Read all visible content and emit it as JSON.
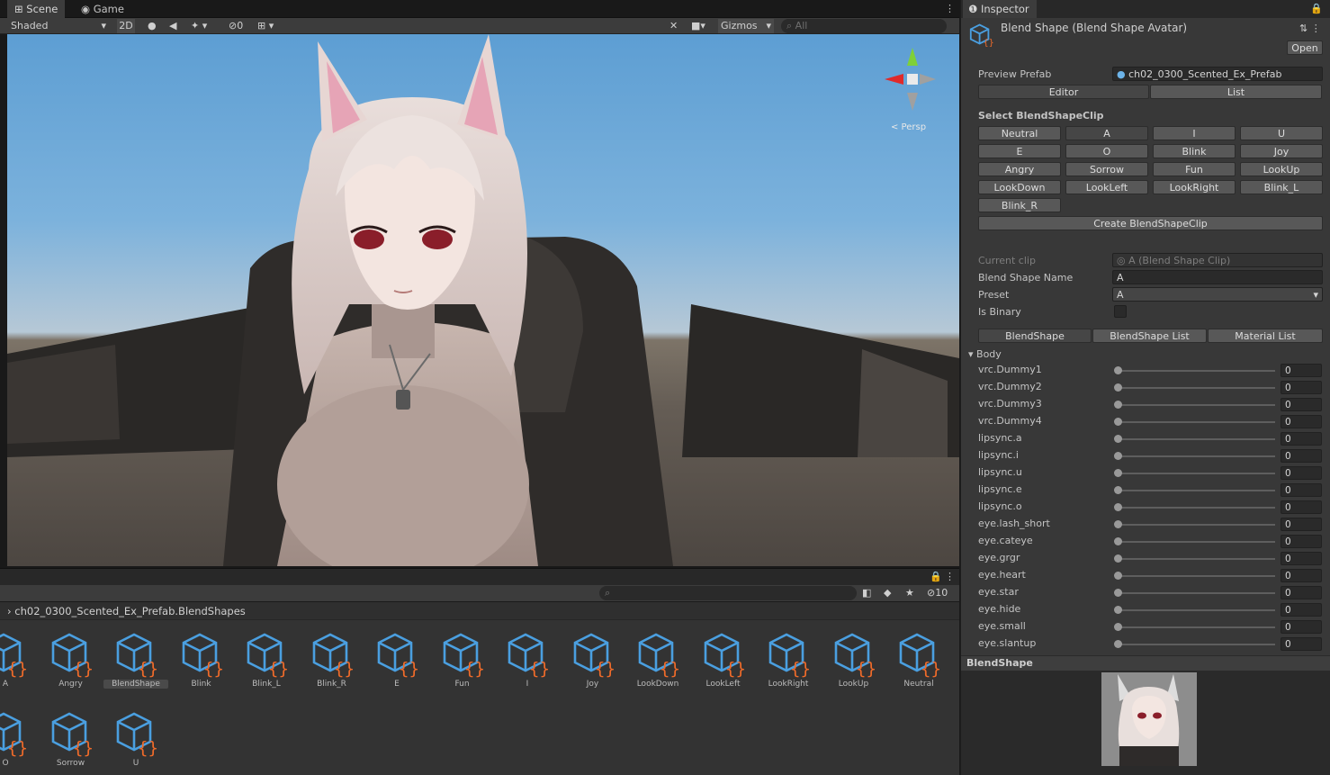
{
  "scene": {
    "tabs": [
      {
        "label": "Scene",
        "icon": "grid-icon"
      },
      {
        "label": "Game",
        "icon": "gamepad-icon"
      }
    ],
    "shading_mode": "Shaded",
    "toggle_2d": "2D",
    "hidden_count": "0",
    "gizmos_label": "Gizmos",
    "search_placeholder": "All",
    "persp_label": "< Persp"
  },
  "project": {
    "breadcrumb": "ch02_0300_Scented_Ex_Prefab.BlendShapes",
    "hidden_count": "10",
    "assets": [
      "A",
      "Angry",
      "BlendShape",
      "Blink",
      "Blink_L",
      "Blink_R",
      "E",
      "Fun",
      "I",
      "Joy",
      "LookDown",
      "LookLeft",
      "LookRight",
      "LookUp",
      "Neutral",
      "O",
      "Sorrow",
      "U"
    ],
    "selected_asset": "BlendShape"
  },
  "inspector": {
    "tab_label": "Inspector",
    "title": "Blend Shape (Blend Shape Avatar)",
    "open_button": "Open",
    "preview_prefab_label": "Preview Prefab",
    "preview_prefab_value": "ch02_0300_Scented_Ex_Prefab",
    "mode_tabs": [
      "Editor",
      "List"
    ],
    "select_clip_heading": "Select BlendShapeClip",
    "clip_buttons": [
      "Neutral",
      "A",
      "I",
      "U",
      "E",
      "O",
      "Blink",
      "Joy",
      "Angry",
      "Sorrow",
      "Fun",
      "LookUp",
      "LookDown",
      "LookLeft",
      "LookRight",
      "Blink_L",
      "Blink_R"
    ],
    "create_button": "Create BlendShapeClip",
    "current_clip_label": "Current clip",
    "current_clip_value": "A (Blend Shape Clip)",
    "blend_shape_name_label": "Blend Shape Name",
    "blend_shape_name_value": "A",
    "preset_label": "Preset",
    "preset_value": "A",
    "is_binary_label": "Is Binary",
    "sub_tabs": [
      "BlendShape",
      "BlendShape List",
      "Material List"
    ],
    "group_label": "Body",
    "shapes": [
      {
        "name": "vrc.Dummy1",
        "value": "0"
      },
      {
        "name": "vrc.Dummy2",
        "value": "0"
      },
      {
        "name": "vrc.Dummy3",
        "value": "0"
      },
      {
        "name": "vrc.Dummy4",
        "value": "0"
      },
      {
        "name": "lipsync.a",
        "value": "0"
      },
      {
        "name": "lipsync.i",
        "value": "0"
      },
      {
        "name": "lipsync.u",
        "value": "0"
      },
      {
        "name": "lipsync.e",
        "value": "0"
      },
      {
        "name": "lipsync.o",
        "value": "0"
      },
      {
        "name": "eye.lash_short",
        "value": "0"
      },
      {
        "name": "eye.cateye",
        "value": "0"
      },
      {
        "name": "eye.grgr",
        "value": "0"
      },
      {
        "name": "eye.heart",
        "value": "0"
      },
      {
        "name": "eye.star",
        "value": "0"
      },
      {
        "name": "eye.hide",
        "value": "0"
      },
      {
        "name": "eye.small",
        "value": "0"
      },
      {
        "name": "eye.slantup",
        "value": "0"
      }
    ],
    "preview_heading": "BlendShape"
  },
  "colors": {
    "accent_blue": "#4a9fe0",
    "accent_orange": "#f06b2a",
    "panel": "#383838"
  }
}
